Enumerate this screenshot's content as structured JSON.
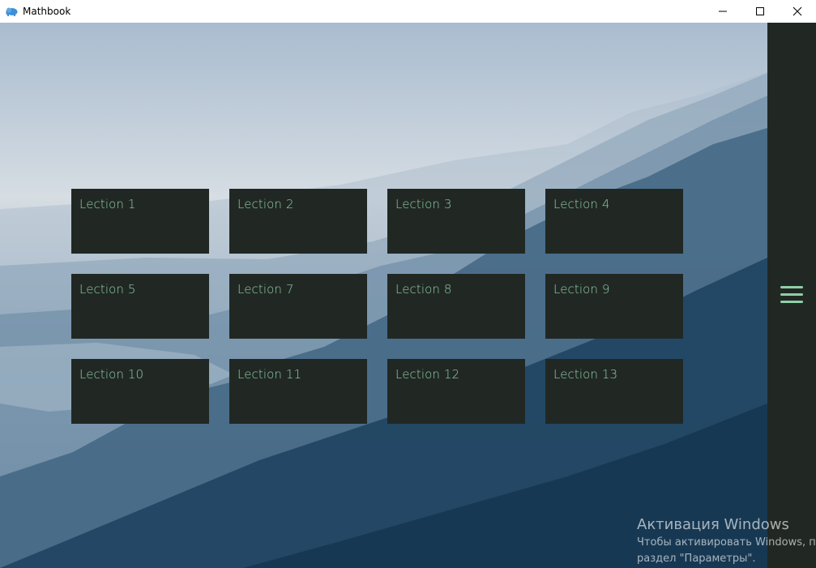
{
  "window": {
    "title": "Mathbook",
    "app_icon": "elephant-icon",
    "controls": [
      "minimize-icon",
      "maximize-icon",
      "close-icon"
    ]
  },
  "lessons": [
    {
      "label": "Lection 1"
    },
    {
      "label": "Lection 2"
    },
    {
      "label": "Lection 3"
    },
    {
      "label": "Lection 4"
    },
    {
      "label": "Lection 5"
    },
    {
      "label": "Lection 7"
    },
    {
      "label": "Lection 8"
    },
    {
      "label": "Lection 9"
    },
    {
      "label": "Lection 10"
    },
    {
      "label": "Lection 11"
    },
    {
      "label": "Lection 12"
    },
    {
      "label": "Lection 13"
    }
  ],
  "sidebar": {
    "menu_icon": "hamburger-menu-icon"
  },
  "watermark": {
    "title": "Активация Windows",
    "line1": "Чтобы активировать Windows, п",
    "line2": "раздел \"Параметры\"."
  },
  "colors": {
    "card_bg": "#212824",
    "accent": "#8fcfa7",
    "sidebar_bg": "#212824"
  }
}
